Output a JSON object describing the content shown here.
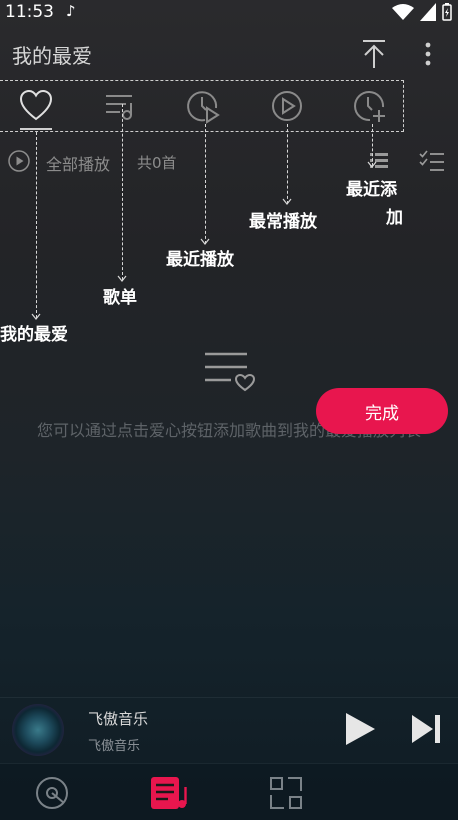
{
  "status": {
    "time": "11:53",
    "note_icon": "music-note-icon"
  },
  "header": {
    "title": "我的最爱"
  },
  "tabs": [
    {
      "id": "favorites",
      "icon": "heart-icon"
    },
    {
      "id": "playlist",
      "icon": "playlist-icon"
    },
    {
      "id": "recent_played",
      "icon": "clock-play-icon"
    },
    {
      "id": "most_played",
      "icon": "circle-play-icon"
    },
    {
      "id": "recent_added",
      "icon": "clock-add-icon"
    }
  ],
  "play_all": {
    "label": "全部播放",
    "count": "共0首"
  },
  "guides": {
    "favorites": "我的最爱",
    "playlist": "歌单",
    "recent_played": "最近播放",
    "most_played": "最常播放",
    "recent_added_line1": "最近添",
    "recent_added_line2": "加"
  },
  "empty": {
    "message": "您可以通过点击爱心按钮添加歌曲到我的最爱播放列表"
  },
  "done_button": {
    "label": "完成"
  },
  "player": {
    "title": "飞傲音乐",
    "artist": "飞傲音乐"
  },
  "colors": {
    "accent": "#e8164e",
    "text_dim": "#8c8c8c"
  }
}
